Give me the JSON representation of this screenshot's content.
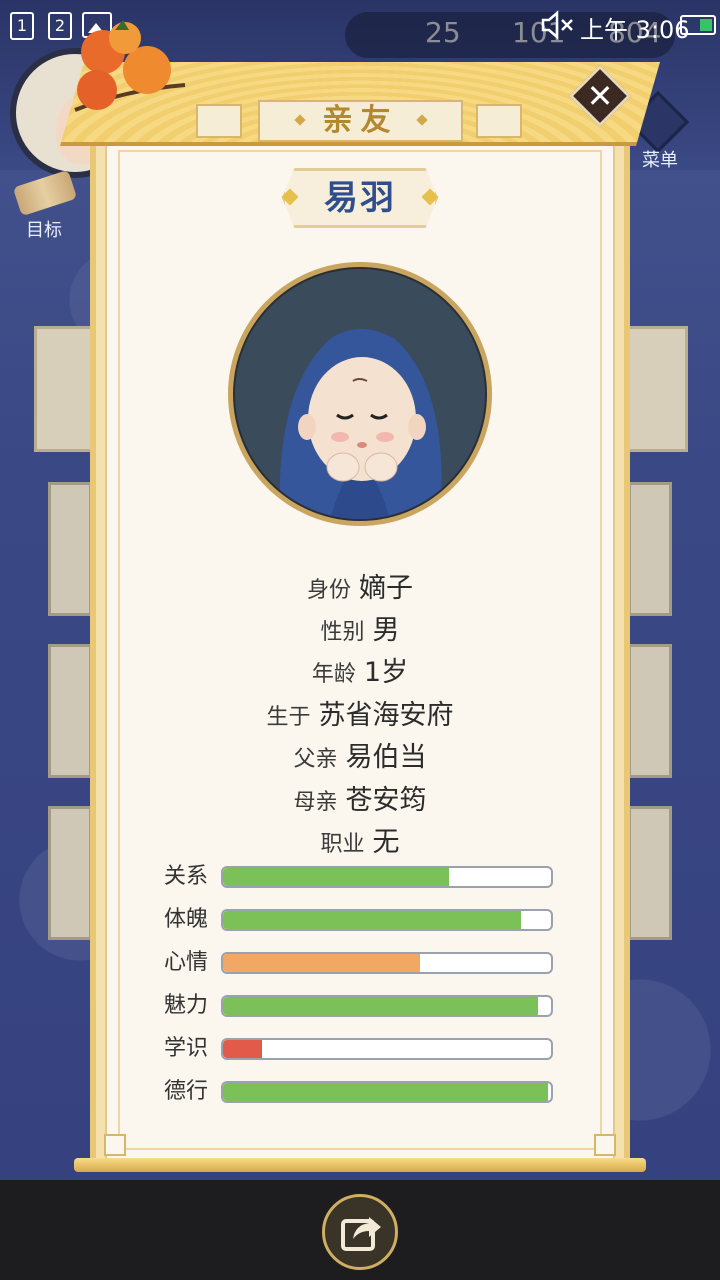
{
  "status_bar": {
    "sim1": "1",
    "sim2": "2",
    "time": "上午 3:06",
    "icons": [
      "sim-1-icon",
      "sim-2-icon",
      "gallery-icon",
      "mute-icon",
      "battery-icon"
    ]
  },
  "resources": {
    "silver": "25",
    "ingot": "101",
    "coin": "804"
  },
  "background": {
    "target_label": "目标",
    "menu_label": "菜单"
  },
  "dialog": {
    "title": "亲友",
    "close_icon": "close-icon",
    "person": {
      "name": "易羽",
      "info": [
        {
          "label": "身份",
          "value": "嫡子"
        },
        {
          "label": "性别",
          "value": "男"
        },
        {
          "label": "年龄",
          "value": "1岁"
        },
        {
          "label": "生于",
          "value": "苏省海安府"
        },
        {
          "label": "父亲",
          "value": "易伯当"
        },
        {
          "label": "母亲",
          "value": "苍安筠"
        },
        {
          "label": "职业",
          "value": "无"
        }
      ],
      "stats": [
        {
          "label": "关系",
          "fraction": 0.69,
          "color": "#7cc157"
        },
        {
          "label": "体魄",
          "fraction": 0.91,
          "color": "#7cc157"
        },
        {
          "label": "心情",
          "fraction": 0.6,
          "color": "#f2a865"
        },
        {
          "label": "魅力",
          "fraction": 0.96,
          "color": "#7cc157"
        },
        {
          "label": "学识",
          "fraction": 0.12,
          "color": "#e25a4a"
        },
        {
          "label": "德行",
          "fraction": 0.99,
          "color": "#7cc157"
        }
      ]
    }
  },
  "bottom": {
    "share_icon": "share-icon"
  }
}
